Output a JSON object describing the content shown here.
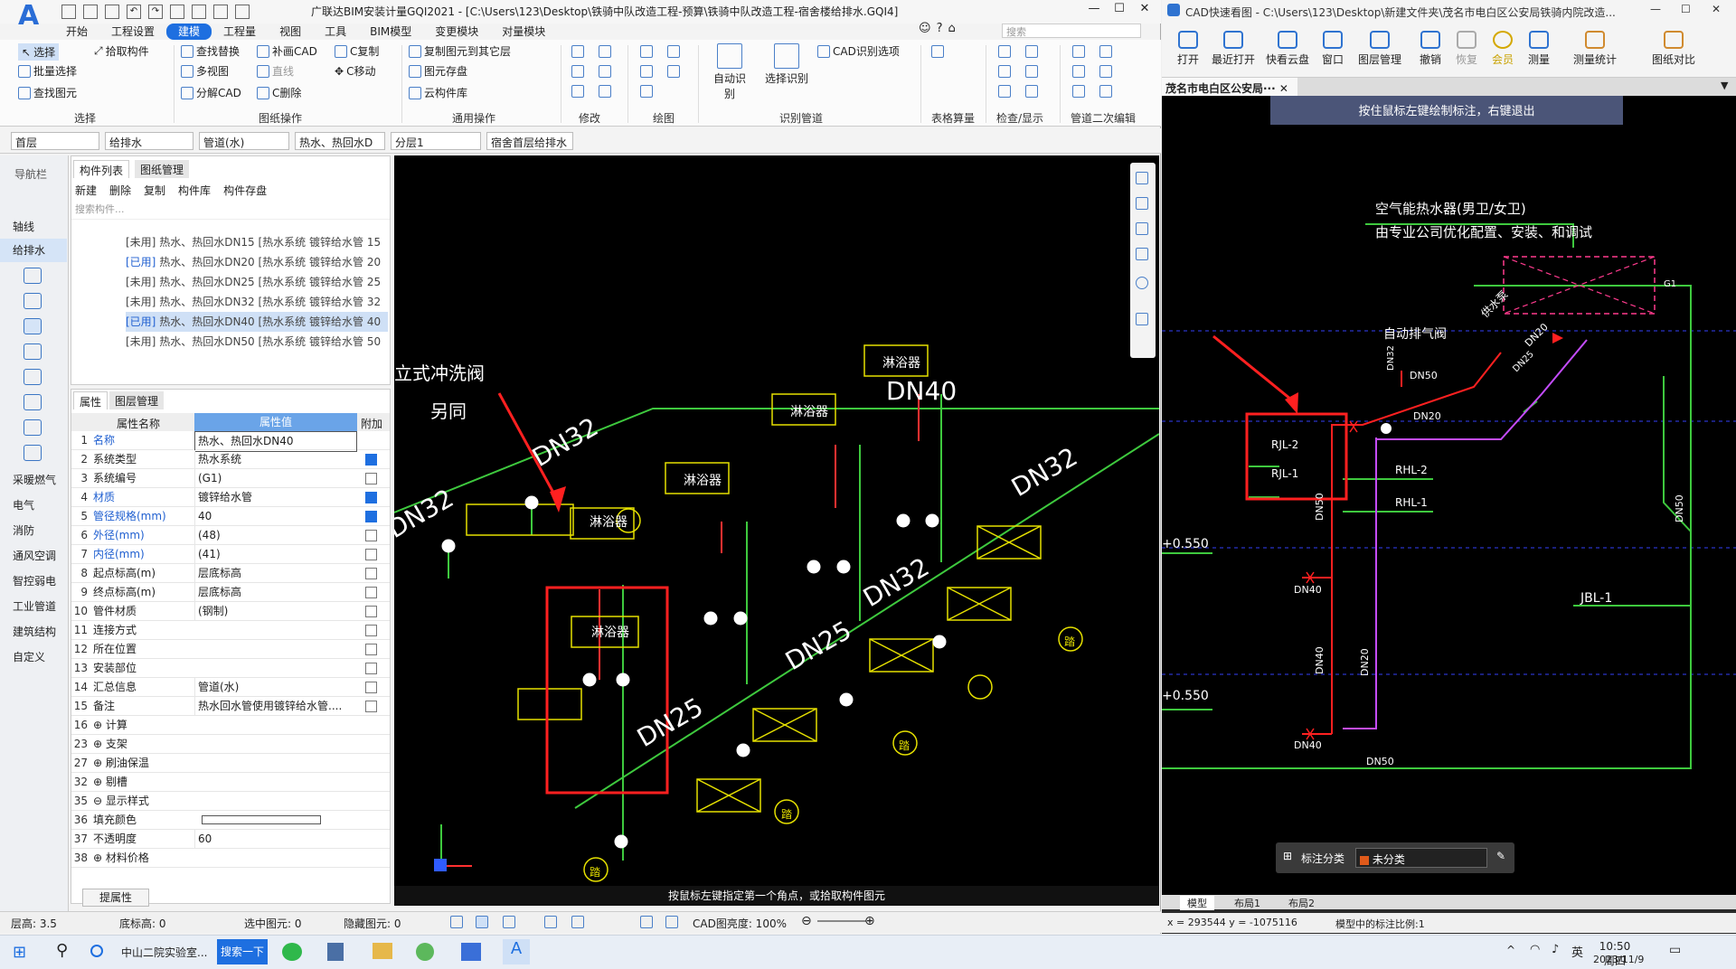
{
  "left_app": {
    "title": "广联达BIM安装计量GQI2021 - [C:\\Users\\123\\Desktop\\铁骑中队改造工程-预算\\铁骑中队改造工程-宿舍楼给排水.GQI4]",
    "menu": [
      "开始",
      "工程设置",
      "建模",
      "工程量",
      "视图",
      "工具",
      "BIM模型",
      "变更模块",
      "对量模块"
    ],
    "active_menu": "建模",
    "search_placeholder": "搜索",
    "ribbon": {
      "select": [
        "选择",
        "批量选择",
        "查找图元"
      ],
      "pick": "拾取构件",
      "drawing_ops": [
        "查找替换",
        "补画CAD",
        "C复制",
        "多视图",
        "直线",
        "C移动",
        "分解CAD",
        "C删除"
      ],
      "common_ops": [
        "复制图元到其它层",
        "图元存盘",
        "云构件库"
      ],
      "cad_recognize": [
        "自动识别",
        "选择识别",
        "CAD识别选项"
      ],
      "groups": [
        "选择",
        "图纸操作",
        "通用操作",
        "修改",
        "绘图",
        "识别管道",
        "表格算量",
        "检查/显示",
        "管道二次编辑"
      ]
    },
    "combos": [
      "首层",
      "给排水",
      "管道(水)",
      "热水、热回水D",
      "分层1",
      "宿舍首层给排水"
    ],
    "nav": {
      "title": "导航栏",
      "items": [
        "轴线",
        "给排水",
        "采暖燃气",
        "电气",
        "消防",
        "通风空调",
        "智控弱电",
        "工业管道",
        "建筑结构",
        "自定义"
      ]
    },
    "component_panel": {
      "tabs": [
        "构件列表",
        "图纸管理"
      ],
      "toolbar": [
        "新建",
        "删除",
        "复制",
        "构件库",
        "构件存盘"
      ],
      "search_placeholder": "搜索构件...",
      "rows": [
        {
          "status": "[未用]",
          "text": "热水、热回水DN15 [热水系统 镀锌给水管 15"
        },
        {
          "status": "[已用]",
          "text": "热水、热回水DN20 [热水系统 镀锌给水管 20"
        },
        {
          "status": "[未用]",
          "text": "热水、热回水DN25 [热水系统 镀锌给水管 25"
        },
        {
          "status": "[未用]",
          "text": "热水、热回水DN32 [热水系统 镀锌给水管 32"
        },
        {
          "status": "[已用]",
          "text": "热水、热回水DN40 [热水系统 镀锌给水管 40"
        },
        {
          "status": "[未用]",
          "text": "热水、热回水DN50 [热水系统 镀锌给水管 50"
        }
      ]
    },
    "property_panel": {
      "tabs": [
        "属性",
        "图层管理"
      ],
      "headers": [
        "属性名称",
        "属性值",
        "附加"
      ],
      "rows": [
        {
          "n": "1",
          "k": "名称",
          "v": "热水、热回水DN40",
          "c": null,
          "blue": true
        },
        {
          "n": "2",
          "k": "系统类型",
          "v": "热水系统",
          "c": true,
          "blue": false
        },
        {
          "n": "3",
          "k": "系统编号",
          "v": "(G1)",
          "c": false,
          "blue": false
        },
        {
          "n": "4",
          "k": "材质",
          "v": "镀锌给水管",
          "c": true,
          "blue": true
        },
        {
          "n": "5",
          "k": "管径规格(mm)",
          "v": "40",
          "c": true,
          "blue": true
        },
        {
          "n": "6",
          "k": "外径(mm)",
          "v": "(48)",
          "c": false,
          "blue": true
        },
        {
          "n": "7",
          "k": "内径(mm)",
          "v": "(41)",
          "c": false,
          "blue": true
        },
        {
          "n": "8",
          "k": "起点标高(m)",
          "v": "层底标高",
          "c": false,
          "blue": false
        },
        {
          "n": "9",
          "k": "终点标高(m)",
          "v": "层底标高",
          "c": false,
          "blue": false
        },
        {
          "n": "10",
          "k": "管件材质",
          "v": "(钢制)",
          "c": false,
          "blue": false
        },
        {
          "n": "11",
          "k": "连接方式",
          "v": "",
          "c": false,
          "blue": false
        },
        {
          "n": "12",
          "k": "所在位置",
          "v": "",
          "c": false,
          "blue": false
        },
        {
          "n": "13",
          "k": "安装部位",
          "v": "",
          "c": false,
          "blue": false
        },
        {
          "n": "14",
          "k": "汇总信息",
          "v": "管道(水)",
          "c": false,
          "blue": false
        },
        {
          "n": "15",
          "k": "备注",
          "v": "热水回水管使用镀锌给水管....",
          "c": false,
          "blue": false
        },
        {
          "n": "16",
          "k": "⊕ 计算",
          "v": "",
          "c": null,
          "blue": false
        },
        {
          "n": "23",
          "k": "⊕ 支架",
          "v": "",
          "c": null,
          "blue": false
        },
        {
          "n": "27",
          "k": "⊕ 刷油保温",
          "v": "",
          "c": null,
          "blue": false
        },
        {
          "n": "32",
          "k": "⊕ 剔槽",
          "v": "",
          "c": null,
          "blue": false
        },
        {
          "n": "35",
          "k": "⊖ 显示样式",
          "v": "",
          "c": null,
          "blue": false
        },
        {
          "n": "36",
          "k": "    填充颜色",
          "v": "",
          "c": null,
          "blue": false
        },
        {
          "n": "37",
          "k": "    不透明度",
          "v": "60",
          "c": null,
          "blue": false
        },
        {
          "n": "38",
          "k": "⊕ 材料价格",
          "v": "",
          "c": null,
          "blue": false
        }
      ],
      "button": "提属性"
    },
    "cad": {
      "labels": {
        "valve_title": "立式冲洗阀",
        "tong": "另同",
        "dn40": "DN40",
        "dn32a": "DN32",
        "dn32b": "DN32",
        "dn32c": "DN32",
        "dn32d": "DN32",
        "dn25a": "DN25",
        "dn25b": "DN25",
        "heater": "淋浴器",
        "drain": "踏"
      },
      "hint": "按鼠标左键指定第一个角点，或拾取构件图元"
    },
    "status": {
      "floor": "层高: 3.5",
      "bottom": "底标高: 0",
      "selected": "选中图元: 0",
      "hidden": "隐藏图元: 0",
      "brightness": "CAD图亮度: 100%"
    }
  },
  "right_app": {
    "title": "CAD快速看图 - C:\\Users\\123\\Desktop\\新建文件夹\\茂名市电白区公安局铁骑内院改造...",
    "toolbar": [
      "打开",
      "最近打开",
      "快看云盘",
      "窗口",
      "图层管理",
      "撤销",
      "恢复",
      "会员",
      "测量",
      "测量统计",
      "图纸对比"
    ],
    "tab": "茂名市电白区公安局···",
    "hint": "按住鼠标左键绘制标注，右键退出",
    "cad": {
      "heater_title": "空气能热水器(男卫/女卫)",
      "heater_sub": "由专业公司优化配置、安装、和调试",
      "auto_vent": "自动排气阀",
      "pump": "供水泵",
      "rjl2": "RJL-2",
      "rjl1": "RJL-1",
      "rhl2": "RHL-2",
      "rhl1": "RHL-1",
      "jbl1": "JBL-1",
      "elev1": "+0.550",
      "elev2": "+0.550",
      "dn50a": "DN50",
      "dn20a": "DN20",
      "dn50b": "DN50",
      "dn40a": "DN40",
      "dn40b": "DN40",
      "dn40c": "DN40",
      "dn20b": "DN20",
      "dn50c": "DN50",
      "dn50d": "DN50",
      "dn20c": "DN20",
      "dn32": "DN32",
      "dn25": "DN25",
      "g1": "G1"
    },
    "annot": {
      "label": "标注分类",
      "value": "未分类"
    },
    "layout_tabs": [
      "模型",
      "布局1",
      "布局2"
    ],
    "coords": "x = 293544  y = -1075116",
    "scale": "模型中的标注比例:1"
  },
  "taskbar": {
    "items": [
      "中山二院实验室...",
      "搜索一下"
    ],
    "ime": "英",
    "time": "10:50 周四",
    "date": "2023/11/9"
  }
}
